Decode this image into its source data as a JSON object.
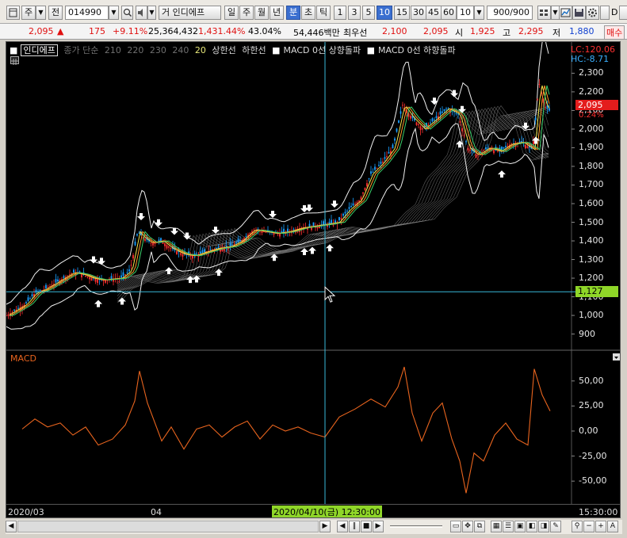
{
  "toolbar": {
    "mode_label": "주",
    "scope_label": "전",
    "stock_code": "014990",
    "market_label": "거",
    "stock_name": "인디에프",
    "period_buttons": [
      "일",
      "주",
      "월",
      "년",
      "분",
      "초",
      "틱"
    ],
    "selected_period": "분",
    "interval_buttons": [
      "1",
      "3",
      "5",
      "10",
      "15",
      "30",
      "45",
      "60"
    ],
    "selected_interval": "10",
    "interval_input": "10",
    "count_value": "900",
    "count_total": "/900",
    "right_labels": [
      "D",
      "C"
    ]
  },
  "quote": {
    "price": "2,095",
    "change_arrow": "▲",
    "change": "175",
    "change_pct": "+9.11%",
    "volume": "25,364,432",
    "volume_pct": "1,431.44%",
    "turnover": "43.04%",
    "amount": "54,446백만",
    "best_label": "최우선",
    "best_price": "2,100",
    "best_price2": "2,095",
    "open_label": "시",
    "open": "1,925",
    "high_label": "고",
    "high": "2,295",
    "low_label": "저",
    "low": "1,880",
    "buy_label": "매수"
  },
  "legend": {
    "box_label": "인디에프",
    "ma_label": "종가 단순",
    "ma_periods": [
      "210",
      "220",
      "230",
      "240",
      "20"
    ],
    "upper_label": "상한선",
    "lower_label": "하한선",
    "macd_up_label": "MACD 0선 상향돌파",
    "macd_down_label": "MACD 0선 하향돌파"
  },
  "info": {
    "lc": "LC:120.06",
    "hc": "HC:-8.71",
    "current_price": "2,095",
    "current_pct": "0.24%",
    "cursor_price": "1,127"
  },
  "price_axis": [
    "2,300",
    "2,200",
    "2,100",
    "2,000",
    "1,900",
    "1,800",
    "1,700",
    "1,600",
    "1,500",
    "1,400",
    "1,300",
    "1,200",
    "1,100",
    "1,000",
    "900"
  ],
  "macd_panel": {
    "title": "MACD",
    "axis": [
      "50,00",
      "25,00",
      "0,00",
      "-25,00",
      "-50,00"
    ]
  },
  "time_axis": {
    "left": "2020/03",
    "mid": "04",
    "cursor": "2020/04/10(금) 12:30:00",
    "right": "15:30:00"
  },
  "colors": {
    "up": "#ff3030",
    "down": "#1aa0ff",
    "macd": "#e8641e",
    "crosshair": "#38b8d8",
    "cursor_box": "#8fd628",
    "price_box": "#e41c1c"
  },
  "chart_data": {
    "type": "line",
    "price_series": [
      {
        "t": 0,
        "p": 1000
      },
      {
        "t": 12,
        "p": 1030
      },
      {
        "t": 24,
        "p": 1060
      },
      {
        "t": 36,
        "p": 1120
      },
      {
        "t": 48,
        "p": 1140
      },
      {
        "t": 60,
        "p": 1170
      },
      {
        "t": 72,
        "p": 1200
      },
      {
        "t": 84,
        "p": 1230
      },
      {
        "t": 96,
        "p": 1220
      },
      {
        "t": 108,
        "p": 1200
      },
      {
        "t": 120,
        "p": 1190
      },
      {
        "t": 132,
        "p": 1195
      },
      {
        "t": 144,
        "p": 1200
      },
      {
        "t": 156,
        "p": 1240
      },
      {
        "t": 166,
        "p": 1450
      },
      {
        "t": 172,
        "p": 1420
      },
      {
        "t": 182,
        "p": 1390
      },
      {
        "t": 196,
        "p": 1400
      },
      {
        "t": 208,
        "p": 1360
      },
      {
        "t": 222,
        "p": 1330
      },
      {
        "t": 236,
        "p": 1320
      },
      {
        "t": 250,
        "p": 1340
      },
      {
        "t": 266,
        "p": 1360
      },
      {
        "t": 282,
        "p": 1370
      },
      {
        "t": 296,
        "p": 1400
      },
      {
        "t": 312,
        "p": 1460
      },
      {
        "t": 326,
        "p": 1450
      },
      {
        "t": 340,
        "p": 1440
      },
      {
        "t": 356,
        "p": 1450
      },
      {
        "t": 372,
        "p": 1470
      },
      {
        "t": 388,
        "p": 1480
      },
      {
        "t": 404,
        "p": 1490
      },
      {
        "t": 418,
        "p": 1500
      },
      {
        "t": 432,
        "p": 1570
      },
      {
        "t": 446,
        "p": 1620
      },
      {
        "t": 460,
        "p": 1760
      },
      {
        "t": 474,
        "p": 1820
      },
      {
        "t": 488,
        "p": 1900
      },
      {
        "t": 500,
        "p": 2130
      },
      {
        "t": 512,
        "p": 2060
      },
      {
        "t": 526,
        "p": 2000
      },
      {
        "t": 540,
        "p": 2050
      },
      {
        "t": 556,
        "p": 2110
      },
      {
        "t": 570,
        "p": 2080
      },
      {
        "t": 582,
        "p": 1900
      },
      {
        "t": 594,
        "p": 1860
      },
      {
        "t": 608,
        "p": 1900
      },
      {
        "t": 622,
        "p": 1880
      },
      {
        "t": 636,
        "p": 1920
      },
      {
        "t": 650,
        "p": 1930
      },
      {
        "t": 664,
        "p": 1890
      },
      {
        "t": 672,
        "p": 2250
      },
      {
        "t": 680,
        "p": 2120
      },
      {
        "t": 686,
        "p": 2095
      }
    ],
    "macd_series": [
      {
        "t": 20,
        "v": 2
      },
      {
        "t": 36,
        "v": 12
      },
      {
        "t": 52,
        "v": 4
      },
      {
        "t": 68,
        "v": 8
      },
      {
        "t": 84,
        "v": -4
      },
      {
        "t": 100,
        "v": 4
      },
      {
        "t": 116,
        "v": -14
      },
      {
        "t": 134,
        "v": -8
      },
      {
        "t": 150,
        "v": 6
      },
      {
        "t": 162,
        "v": 30
      },
      {
        "t": 168,
        "v": 60
      },
      {
        "t": 178,
        "v": 28
      },
      {
        "t": 196,
        "v": -10
      },
      {
        "t": 208,
        "v": 4
      },
      {
        "t": 224,
        "v": -18
      },
      {
        "t": 240,
        "v": 2
      },
      {
        "t": 256,
        "v": 6
      },
      {
        "t": 272,
        "v": -6
      },
      {
        "t": 288,
        "v": 4
      },
      {
        "t": 304,
        "v": 10
      },
      {
        "t": 320,
        "v": -8
      },
      {
        "t": 336,
        "v": 6
      },
      {
        "t": 352,
        "v": 0
      },
      {
        "t": 368,
        "v": 4
      },
      {
        "t": 384,
        "v": -2
      },
      {
        "t": 402,
        "v": -6
      },
      {
        "t": 420,
        "v": 14
      },
      {
        "t": 440,
        "v": 22
      },
      {
        "t": 460,
        "v": 32
      },
      {
        "t": 478,
        "v": 24
      },
      {
        "t": 494,
        "v": 44
      },
      {
        "t": 502,
        "v": 64
      },
      {
        "t": 512,
        "v": 18
      },
      {
        "t": 524,
        "v": -10
      },
      {
        "t": 538,
        "v": 18
      },
      {
        "t": 550,
        "v": 28
      },
      {
        "t": 562,
        "v": -8
      },
      {
        "t": 572,
        "v": -30
      },
      {
        "t": 580,
        "v": -62
      },
      {
        "t": 590,
        "v": -22
      },
      {
        "t": 602,
        "v": -30
      },
      {
        "t": 616,
        "v": -4
      },
      {
        "t": 630,
        "v": 8
      },
      {
        "t": 644,
        "v": -8
      },
      {
        "t": 658,
        "v": -14
      },
      {
        "t": 666,
        "v": 62
      },
      {
        "t": 676,
        "v": 36
      },
      {
        "t": 686,
        "v": 20
      }
    ],
    "price_range": [
      860,
      2340
    ],
    "macd_range": [
      -72,
      72
    ],
    "cursor_price": 1127,
    "cursor_t": 402,
    "buy_signals_t": [
      116,
      146,
      205,
      232,
      240,
      268,
      338,
      376,
      386,
      408,
      572,
      625,
      668
    ],
    "sell_signals_t": [
      110,
      120,
      170,
      192,
      212,
      228,
      264,
      336,
      376,
      382,
      414,
      540,
      565,
      575,
      655
    ]
  }
}
